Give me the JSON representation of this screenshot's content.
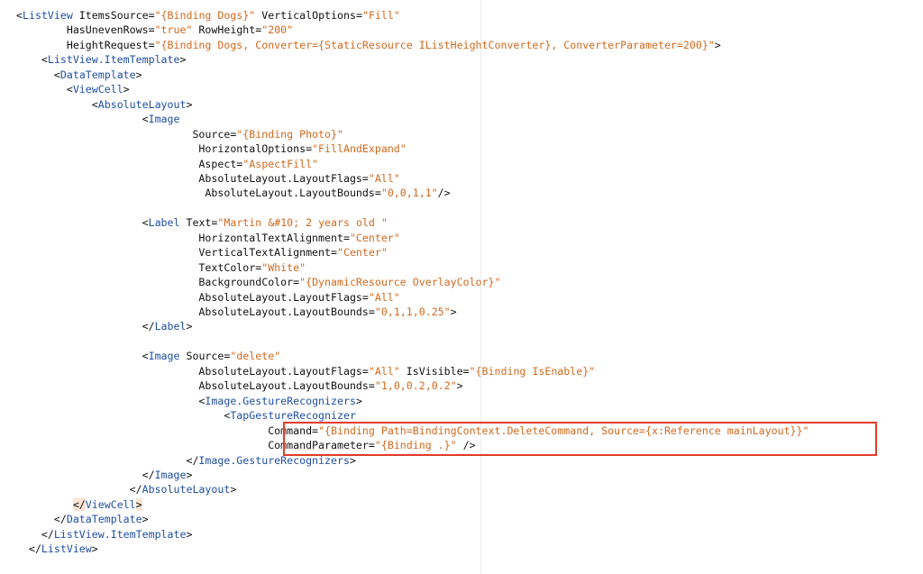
{
  "editor": {
    "lines": [
      [
        {
          "t": "<",
          "c": "punc"
        },
        {
          "t": "ListView",
          "c": "tag"
        },
        {
          "t": " ItemsSource=",
          "c": "attr"
        },
        {
          "t": "\"{Binding Dogs}\"",
          "c": "val"
        },
        {
          "t": " VerticalOptions=",
          "c": "attr"
        },
        {
          "t": "\"Fill\"",
          "c": "val"
        }
      ],
      [
        {
          "t": "        HasUnevenRows=",
          "c": "attr"
        },
        {
          "t": "\"true\"",
          "c": "val"
        },
        {
          "t": " RowHeight=",
          "c": "attr"
        },
        {
          "t": "\"200\"",
          "c": "val"
        }
      ],
      [
        {
          "t": "        HeightRequest=",
          "c": "attr"
        },
        {
          "t": "\"{Binding Dogs, Converter={StaticResource IListHeightConverter}, ConverterParameter=200}\"",
          "c": "val"
        },
        {
          "t": ">",
          "c": "punc"
        }
      ],
      [
        {
          "t": "    <",
          "c": "punc"
        },
        {
          "t": "ListView.ItemTemplate",
          "c": "tag"
        },
        {
          "t": ">",
          "c": "punc"
        }
      ],
      [
        {
          "t": "      <",
          "c": "punc"
        },
        {
          "t": "DataTemplate",
          "c": "tag"
        },
        {
          "t": ">",
          "c": "punc"
        }
      ],
      [
        {
          "t": "        <",
          "c": "punc"
        },
        {
          "t": "ViewCell",
          "c": "tag"
        },
        {
          "t": ">",
          "c": "punc"
        }
      ],
      [
        {
          "t": "            <",
          "c": "punc"
        },
        {
          "t": "AbsoluteLayout",
          "c": "tag"
        },
        {
          "t": ">",
          "c": "punc"
        }
      ],
      [
        {
          "t": "                    <",
          "c": "punc"
        },
        {
          "t": "Image",
          "c": "tag"
        }
      ],
      [
        {
          "t": "                            Source=",
          "c": "attr"
        },
        {
          "t": "\"{Binding Photo}\"",
          "c": "val"
        }
      ],
      [
        {
          "t": "                             HorizontalOptions=",
          "c": "attr"
        },
        {
          "t": "\"FillAndExpand\"",
          "c": "val"
        }
      ],
      [
        {
          "t": "                             Aspect=",
          "c": "attr"
        },
        {
          "t": "\"AspectFill\"",
          "c": "val"
        }
      ],
      [
        {
          "t": "                             AbsoluteLayout.LayoutFlags=",
          "c": "attr"
        },
        {
          "t": "\"All\"",
          "c": "val"
        }
      ],
      [
        {
          "t": "                              AbsoluteLayout.LayoutBounds=",
          "c": "attr"
        },
        {
          "t": "\"0,0,1,1\"",
          "c": "val"
        },
        {
          "t": "/>",
          "c": "punc"
        }
      ],
      [],
      [
        {
          "t": "                    <",
          "c": "punc"
        },
        {
          "t": "Label",
          "c": "tag"
        },
        {
          "t": " Text=",
          "c": "attr"
        },
        {
          "t": "\"Martin &#10; 2 years old \"",
          "c": "val"
        }
      ],
      [
        {
          "t": "                             HorizontalTextAlignment=",
          "c": "attr"
        },
        {
          "t": "\"Center\"",
          "c": "val"
        }
      ],
      [
        {
          "t": "                             VerticalTextAlignment=",
          "c": "attr"
        },
        {
          "t": "\"Center\"",
          "c": "val"
        }
      ],
      [
        {
          "t": "                             TextColor=",
          "c": "attr"
        },
        {
          "t": "\"White\"",
          "c": "val"
        }
      ],
      [
        {
          "t": "                             BackgroundColor=",
          "c": "attr"
        },
        {
          "t": "\"{DynamicResource OverlayColor}\"",
          "c": "val"
        }
      ],
      [
        {
          "t": "                             AbsoluteLayout.LayoutFlags=",
          "c": "attr"
        },
        {
          "t": "\"All\"",
          "c": "val"
        }
      ],
      [
        {
          "t": "                             AbsoluteLayout.LayoutBounds=",
          "c": "attr"
        },
        {
          "t": "\"0,1,1,0.25\"",
          "c": "val"
        },
        {
          "t": ">",
          "c": "punc"
        }
      ],
      [
        {
          "t": "                    </",
          "c": "punc"
        },
        {
          "t": "Label",
          "c": "tag"
        },
        {
          "t": ">",
          "c": "punc"
        }
      ],
      [],
      [
        {
          "t": "                    <",
          "c": "punc"
        },
        {
          "t": "Image",
          "c": "tag"
        },
        {
          "t": " Source=",
          "c": "attr"
        },
        {
          "t": "\"delete\"",
          "c": "val"
        }
      ],
      [
        {
          "t": "                             AbsoluteLayout.LayoutFlags=",
          "c": "attr"
        },
        {
          "t": "\"All\"",
          "c": "val"
        },
        {
          "t": " IsVisible=",
          "c": "attr"
        },
        {
          "t": "\"{Binding IsEnable}\"",
          "c": "val"
        }
      ],
      [
        {
          "t": "                             AbsoluteLayout.LayoutBounds=",
          "c": "attr"
        },
        {
          "t": "\"1,0,0.2,0.2\"",
          "c": "val"
        },
        {
          "t": ">",
          "c": "punc"
        }
      ],
      [
        {
          "t": "                             <",
          "c": "punc"
        },
        {
          "t": "Image.GestureRecognizers",
          "c": "tag"
        },
        {
          "t": ">",
          "c": "punc"
        }
      ],
      [
        {
          "t": "                                 <",
          "c": "punc"
        },
        {
          "t": "TapGestureRecognizer",
          "c": "tag"
        }
      ],
      [
        {
          "t": "                                        Command=",
          "c": "attr"
        },
        {
          "t": "\"{Binding Path=BindingContext.DeleteCommand, Source={x:Reference mainLayout}}\"",
          "c": "val"
        }
      ],
      [
        {
          "t": "                                        CommandParameter=",
          "c": "attr"
        },
        {
          "t": "\"{Binding .}\"",
          "c": "val"
        },
        {
          "t": " />",
          "c": "punc"
        }
      ],
      [
        {
          "t": "                           </",
          "c": "punc"
        },
        {
          "t": "Image.GestureRecognizers",
          "c": "tag"
        },
        {
          "t": ">",
          "c": "punc"
        }
      ],
      [
        {
          "t": "                    </",
          "c": "punc"
        },
        {
          "t": "Image",
          "c": "tag"
        },
        {
          "t": ">",
          "c": "punc"
        }
      ],
      [
        {
          "t": "                  </",
          "c": "punc"
        },
        {
          "t": "AbsoluteLayout",
          "c": "tag"
        },
        {
          "t": ">",
          "c": "punc"
        }
      ],
      [
        {
          "t": "         ",
          "c": "attr"
        },
        {
          "t": "</",
          "c": "hl"
        },
        {
          "t": "ViewCell",
          "c": "tag"
        },
        {
          "t": ">",
          "c": "hl"
        }
      ],
      [
        {
          "t": "      </",
          "c": "punc"
        },
        {
          "t": "DataTemplate",
          "c": "tag"
        },
        {
          "t": ">",
          "c": "punc"
        }
      ],
      [
        {
          "t": "    </",
          "c": "punc"
        },
        {
          "t": "ListView.ItemTemplate",
          "c": "tag"
        },
        {
          "t": ">",
          "c": "punc"
        }
      ],
      [
        {
          "t": "  </",
          "c": "punc"
        },
        {
          "t": "ListView",
          "c": "tag"
        },
        {
          "t": ">",
          "c": "punc"
        }
      ]
    ]
  }
}
